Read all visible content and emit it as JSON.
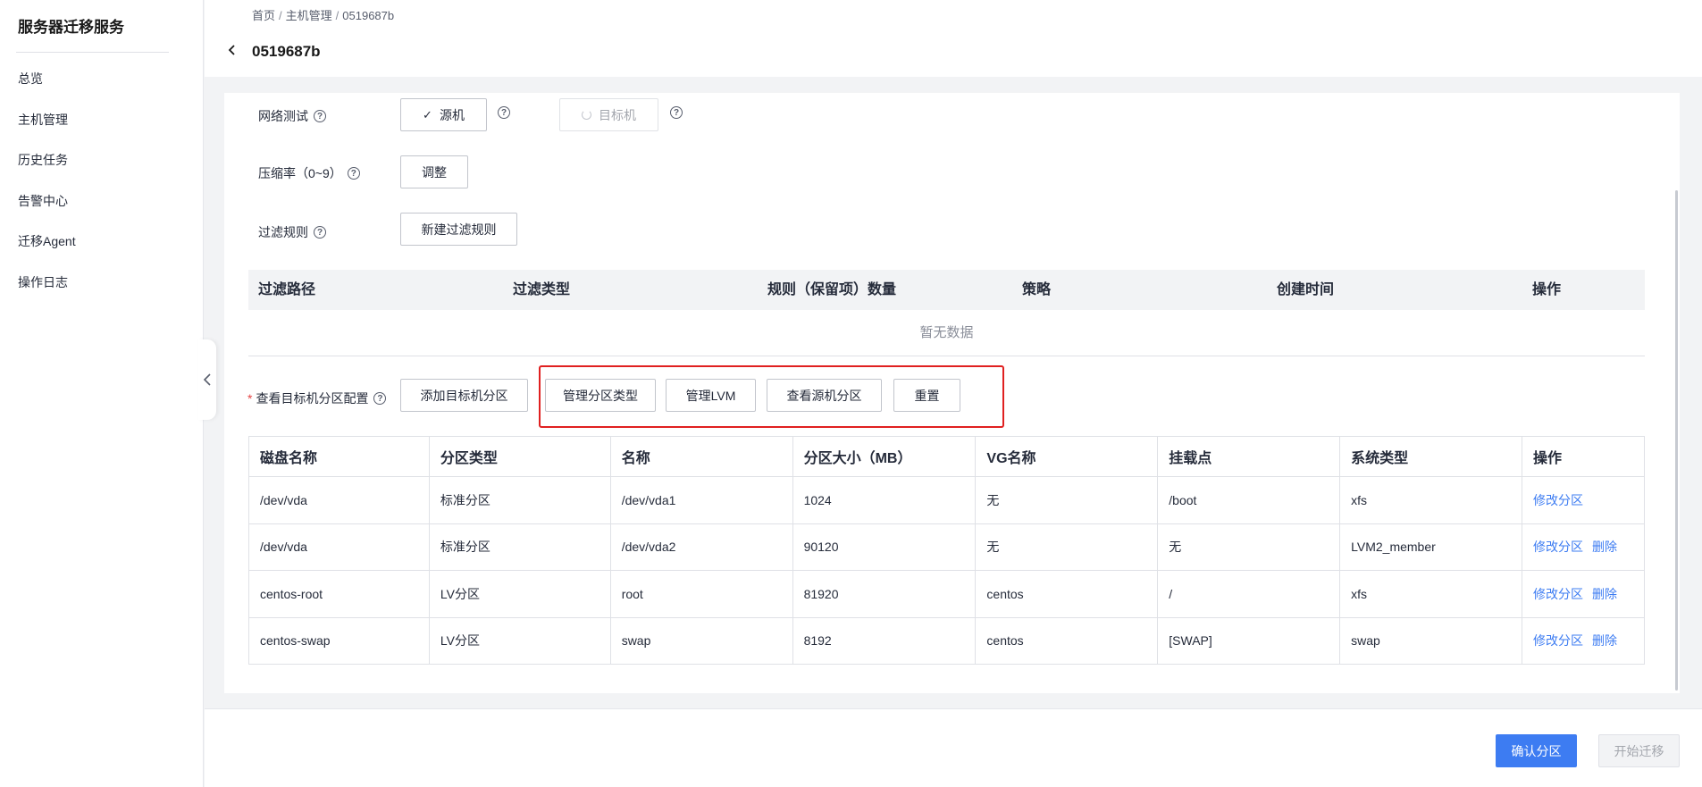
{
  "sidebar": {
    "title": "服务器迁移服务",
    "items": [
      {
        "label": "总览"
      },
      {
        "label": "主机管理"
      },
      {
        "label": "历史任务"
      },
      {
        "label": "告警中心"
      },
      {
        "label": "迁移Agent"
      },
      {
        "label": "操作日志"
      }
    ]
  },
  "header": {
    "breadcrumb": [
      "首页",
      "主机管理",
      "0519687b"
    ],
    "breadcrumb_sep": "/",
    "title": "0519687b"
  },
  "form": {
    "network_test": {
      "label": "网络测试",
      "source_btn": "源机",
      "target_btn": "目标机"
    },
    "compression": {
      "label": "压缩率（0~9）",
      "btn": "调整"
    },
    "filter_rules": {
      "label": "过滤规则",
      "btn": "新建过滤规则"
    },
    "help_glyph": "?"
  },
  "filter_table": {
    "columns": [
      "过滤路径",
      "过滤类型",
      "规则（保留项）数量",
      "策略",
      "创建时间",
      "操作"
    ],
    "empty_text": "暂无数据"
  },
  "partition": {
    "required_mark": "*",
    "label": "查看目标机分区配置",
    "buttons": {
      "add": "添加目标机分区",
      "manage_type": "管理分区类型",
      "manage_lvm": "管理LVM",
      "view_source": "查看源机分区",
      "reset": "重置"
    },
    "columns": [
      "磁盘名称",
      "分区类型",
      "名称",
      "分区大小（MB）",
      "VG名称",
      "挂载点",
      "系统类型",
      "操作"
    ],
    "rows": [
      {
        "disk": "/dev/vda",
        "type": "标准分区",
        "name": "/dev/vda1",
        "size": "1024",
        "vg": "无",
        "mount": "/boot",
        "fs": "xfs",
        "modify": "修改分区",
        "delete": ""
      },
      {
        "disk": "/dev/vda",
        "type": "标准分区",
        "name": "/dev/vda2",
        "size": "90120",
        "vg": "无",
        "mount": "无",
        "fs": "LVM2_member",
        "modify": "修改分区",
        "delete": "删除"
      },
      {
        "disk": "centos-root",
        "type": "LV分区",
        "name": "root",
        "size": "81920",
        "vg": "centos",
        "mount": "/",
        "fs": "xfs",
        "modify": "修改分区",
        "delete": "删除"
      },
      {
        "disk": "centos-swap",
        "type": "LV分区",
        "name": "swap",
        "size": "8192",
        "vg": "centos",
        "mount": "[SWAP]",
        "fs": "swap",
        "modify": "修改分区",
        "delete": "删除"
      }
    ]
  },
  "footer": {
    "confirm": "确认分区",
    "start": "开始迁移"
  },
  "colors": {
    "primary": "#3d7cf2",
    "highlight": "#e02020",
    "required": "#e54545"
  }
}
